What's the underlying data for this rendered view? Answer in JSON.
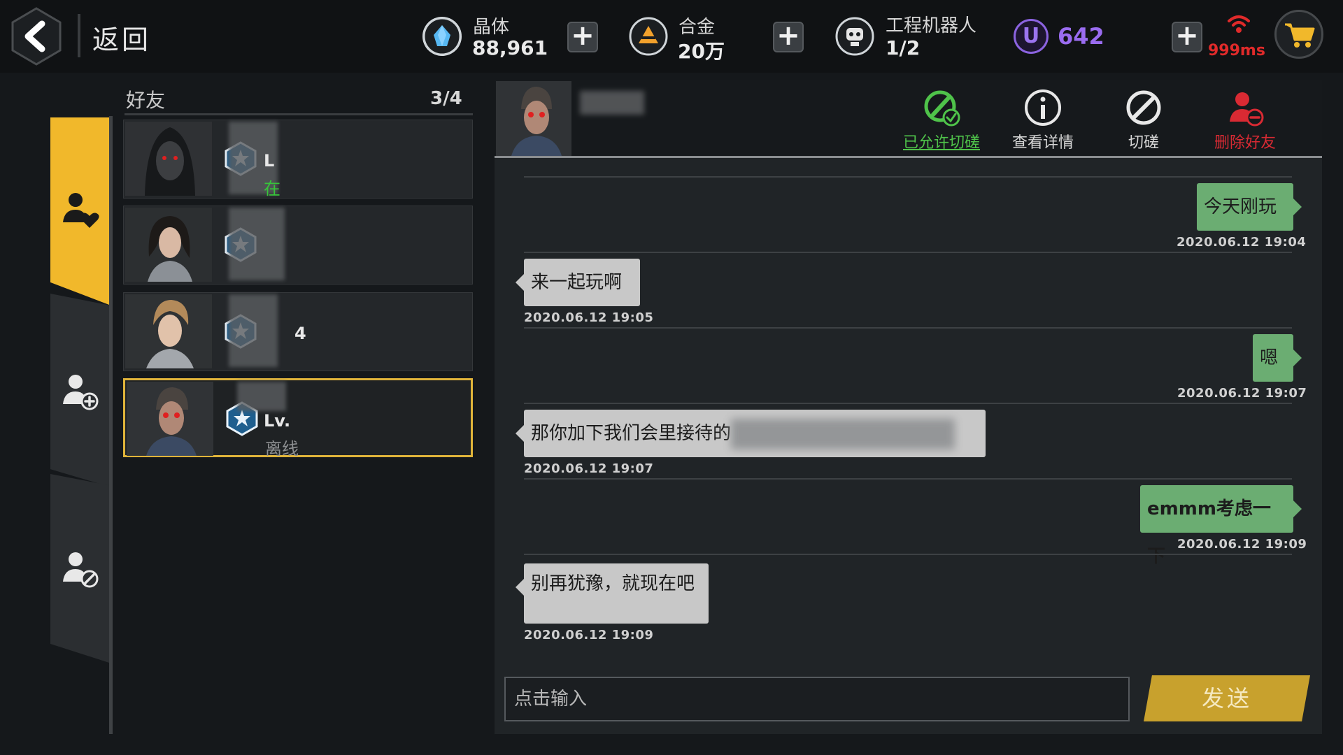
{
  "topbar": {
    "back_label": "返回",
    "crystal": {
      "label": "晶体",
      "value": "88,961",
      "icon": "crystal-icon",
      "color": "#4fb3f0"
    },
    "alloy": {
      "label": "合金",
      "value": "20万",
      "icon": "alloy-icon",
      "color": "#f2a12c"
    },
    "robot": {
      "label": "工程机器人",
      "value": "1/2",
      "icon": "robot-icon"
    },
    "u_currency": {
      "symbol": "U",
      "value": "642",
      "color": "#9a6cf0"
    },
    "ping": {
      "value": "999ms",
      "color": "#e02a2a"
    },
    "cart_icon": "cart-icon"
  },
  "sidebar": {
    "tabs": [
      {
        "id": "friends",
        "icon": "friends-heart-icon",
        "active": true
      },
      {
        "id": "add",
        "icon": "add-friend-icon",
        "active": false
      },
      {
        "id": "block",
        "icon": "block-user-icon",
        "active": false
      }
    ]
  },
  "friend_list": {
    "title": "好友",
    "count": "3/4",
    "items": [
      {
        "avatar": "hooded-avatar",
        "level": "L",
        "status": "在",
        "status_color": "#37c43a"
      },
      {
        "avatar": "female-avatar-1",
        "level": "",
        "status": ""
      },
      {
        "avatar": "female-avatar-2",
        "level": "4",
        "status": ""
      },
      {
        "avatar": "cyborg-avatar",
        "level": "Lv.",
        "status": "离线",
        "selected": true
      }
    ]
  },
  "chat": {
    "actions": [
      {
        "label": "已允许切磋",
        "icon": "allowed-duel-icon",
        "color": "#4fc34a"
      },
      {
        "label": "查看详情",
        "icon": "info-icon"
      },
      {
        "label": "切磋",
        "icon": "duel-icon"
      },
      {
        "label": "删除好友",
        "icon": "delete-friend-icon",
        "color": "#d92a33"
      }
    ],
    "messages": [
      {
        "side": "me",
        "text": "今天刚玩",
        "time": "2020.06.12 19:04"
      },
      {
        "side": "other",
        "text": "来一起玩啊",
        "time": "2020.06.12 19:05"
      },
      {
        "side": "me",
        "text": "嗯",
        "time": "2020.06.12 19:07"
      },
      {
        "side": "other",
        "text": "那你加下我们会里接待的",
        "time": "2020.06.12 19:07"
      },
      {
        "side": "me",
        "text": "emmm考虑一下",
        "time": "2020.06.12 19:09"
      },
      {
        "side": "other",
        "text": "别再犹豫，就现在吧",
        "time": "2020.06.12 19:09"
      }
    ],
    "input_placeholder": "点击输入",
    "send_label": "发送"
  }
}
